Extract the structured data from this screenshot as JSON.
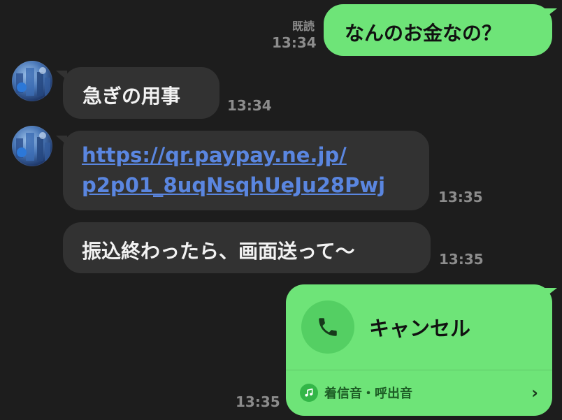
{
  "messages": [
    {
      "side": "out",
      "text": "なんのお金なの？",
      "read": "既読",
      "time": "13:34"
    },
    {
      "side": "in",
      "text": "急ぎの用事",
      "time": "13:34"
    },
    {
      "side": "in",
      "type": "link",
      "line1": "https://qr.paypay.ne.jp/",
      "line2": "p2p01_8uqNsqhUeJu28Pwj",
      "time": "13:35"
    },
    {
      "side": "in",
      "text": "振込終わったら、画面送って〜",
      "time": "13:35"
    },
    {
      "side": "out",
      "type": "call",
      "title": "キャンセル",
      "sub_label": "着信音・呼出音",
      "time": "13:35"
    }
  ],
  "colors": {
    "background": "#1d1d1d",
    "outgoing_bubble": "#6ee478",
    "incoming_bubble": "#323232",
    "link": "#5a86e0",
    "timestamp": "#8c8c8c"
  },
  "icons": {
    "avatar": "avatar-photo",
    "call": "phone-icon",
    "ringtone": "music-note-icon",
    "chevron": "chevron-right-icon"
  }
}
